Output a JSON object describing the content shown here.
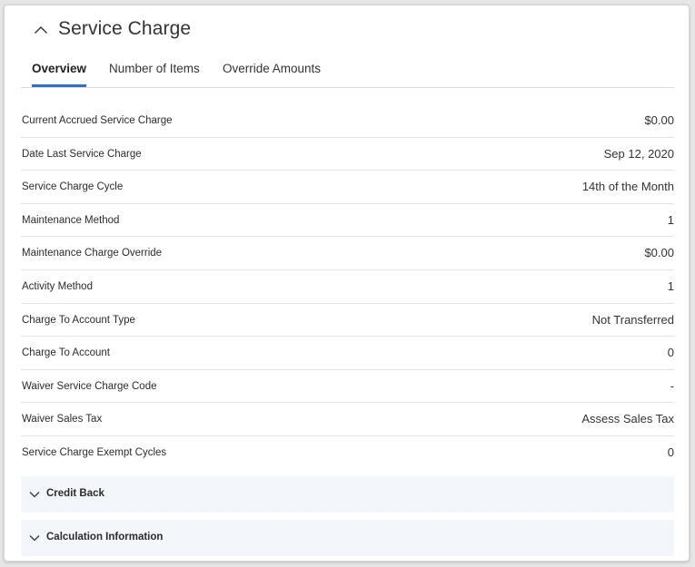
{
  "panel": {
    "title": "Service Charge",
    "collapse_icon": "chevron-up-icon"
  },
  "tabs": [
    {
      "label": "Overview",
      "active": true
    },
    {
      "label": "Number of Items",
      "active": false
    },
    {
      "label": "Override Amounts",
      "active": false
    }
  ],
  "rows": [
    {
      "label": "Current Accrued Service Charge",
      "value": "$0.00"
    },
    {
      "label": "Date Last Service Charge",
      "value": "Sep 12, 2020"
    },
    {
      "label": "Service Charge Cycle",
      "value": "14th of the Month"
    },
    {
      "label": "Maintenance Method",
      "value": "1"
    },
    {
      "label": "Maintenance Charge Override",
      "value": "$0.00"
    },
    {
      "label": "Activity Method",
      "value": "1"
    },
    {
      "label": "Charge To Account Type",
      "value": "Not Transferred"
    },
    {
      "label": "Charge To Account",
      "value": "0"
    },
    {
      "label": "Waiver Service Charge Code",
      "value": "-"
    },
    {
      "label": "Waiver Sales Tax",
      "value": "Assess Sales Tax"
    },
    {
      "label": "Service Charge Exempt Cycles",
      "value": "0"
    }
  ],
  "sections": [
    {
      "label": "Credit Back",
      "icon": "chevron-down-icon"
    },
    {
      "label": "Calculation Information",
      "icon": "chevron-down-icon"
    }
  ],
  "colors": {
    "accent": "#2f6fc6",
    "section_bg": "#f3f6fa",
    "divider": "#e3e3e3"
  }
}
